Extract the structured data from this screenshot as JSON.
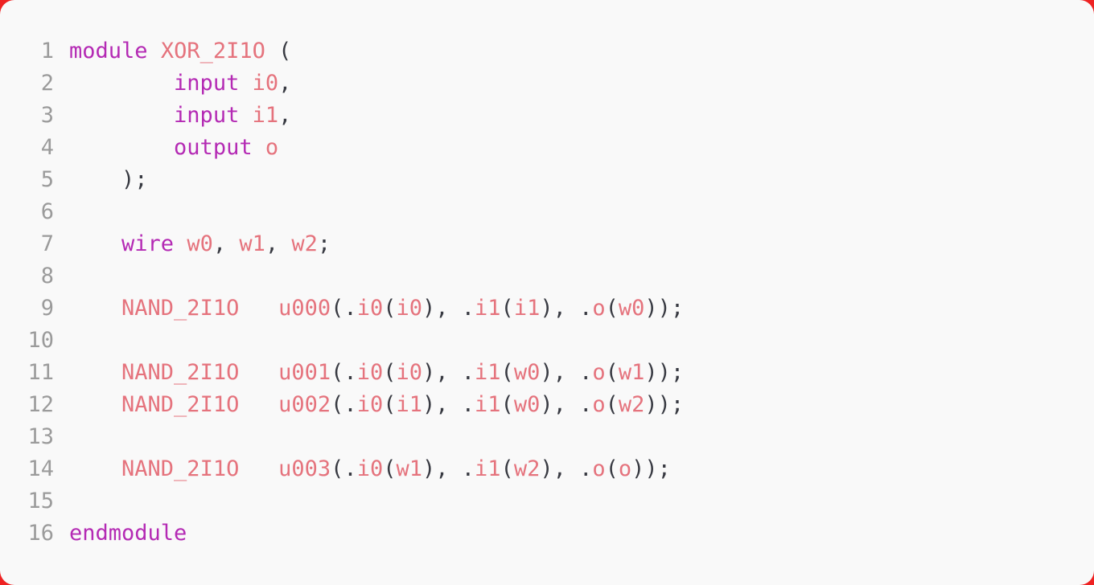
{
  "theme": {
    "page_background": "#ee2222",
    "panel_background": "#f9f9f9",
    "line_number_color": "#9b9b9b",
    "keyword_color": "#b42ab4",
    "identifier_color": "#e5737d",
    "punctuation_color": "#383a42"
  },
  "editor": {
    "language": "verilog",
    "line_count": 16,
    "lines": [
      {
        "number": "1",
        "text": "module XOR_2I1O (",
        "tokens": [
          {
            "t": "module",
            "k": "keyword"
          },
          {
            "t": " ",
            "k": "plain"
          },
          {
            "t": "XOR_2I1O",
            "k": "ident"
          },
          {
            "t": " (",
            "k": "punct"
          }
        ]
      },
      {
        "number": "2",
        "text": "        input i0,",
        "tokens": [
          {
            "t": "        ",
            "k": "plain"
          },
          {
            "t": "input",
            "k": "keyword"
          },
          {
            "t": " ",
            "k": "plain"
          },
          {
            "t": "i0",
            "k": "ident"
          },
          {
            "t": ",",
            "k": "punct"
          }
        ]
      },
      {
        "number": "3",
        "text": "        input i1,",
        "tokens": [
          {
            "t": "        ",
            "k": "plain"
          },
          {
            "t": "input",
            "k": "keyword"
          },
          {
            "t": " ",
            "k": "plain"
          },
          {
            "t": "i1",
            "k": "ident"
          },
          {
            "t": ",",
            "k": "punct"
          }
        ]
      },
      {
        "number": "4",
        "text": "        output o",
        "tokens": [
          {
            "t": "        ",
            "k": "plain"
          },
          {
            "t": "output",
            "k": "keyword"
          },
          {
            "t": " ",
            "k": "plain"
          },
          {
            "t": "o",
            "k": "ident"
          }
        ]
      },
      {
        "number": "5",
        "text": "    );",
        "tokens": [
          {
            "t": "    );",
            "k": "punct"
          }
        ]
      },
      {
        "number": "6",
        "text": "",
        "tokens": []
      },
      {
        "number": "7",
        "text": "    wire w0, w1, w2;",
        "tokens": [
          {
            "t": "    ",
            "k": "plain"
          },
          {
            "t": "wire",
            "k": "keyword"
          },
          {
            "t": " ",
            "k": "plain"
          },
          {
            "t": "w0",
            "k": "ident"
          },
          {
            "t": ", ",
            "k": "punct"
          },
          {
            "t": "w1",
            "k": "ident"
          },
          {
            "t": ", ",
            "k": "punct"
          },
          {
            "t": "w2",
            "k": "ident"
          },
          {
            "t": ";",
            "k": "punct"
          }
        ]
      },
      {
        "number": "8",
        "text": "",
        "tokens": []
      },
      {
        "number": "9",
        "text": "    NAND_2I1O   u000(.i0(i0), .i1(i1), .o(w0));",
        "tokens": [
          {
            "t": "    ",
            "k": "plain"
          },
          {
            "t": "NAND_2I1O",
            "k": "ident"
          },
          {
            "t": "   ",
            "k": "plain"
          },
          {
            "t": "u000",
            "k": "ident"
          },
          {
            "t": "(",
            "k": "punct"
          },
          {
            "t": ".",
            "k": "punct"
          },
          {
            "t": "i0",
            "k": "ident"
          },
          {
            "t": "(",
            "k": "punct"
          },
          {
            "t": "i0",
            "k": "ident"
          },
          {
            "t": "), ",
            "k": "punct"
          },
          {
            "t": ".",
            "k": "punct"
          },
          {
            "t": "i1",
            "k": "ident"
          },
          {
            "t": "(",
            "k": "punct"
          },
          {
            "t": "i1",
            "k": "ident"
          },
          {
            "t": "), ",
            "k": "punct"
          },
          {
            "t": ".",
            "k": "punct"
          },
          {
            "t": "o",
            "k": "ident"
          },
          {
            "t": "(",
            "k": "punct"
          },
          {
            "t": "w0",
            "k": "ident"
          },
          {
            "t": "));",
            "k": "punct"
          }
        ]
      },
      {
        "number": "10",
        "text": "",
        "tokens": []
      },
      {
        "number": "11",
        "text": "    NAND_2I1O   u001(.i0(i0), .i1(w0), .o(w1));",
        "tokens": [
          {
            "t": "    ",
            "k": "plain"
          },
          {
            "t": "NAND_2I1O",
            "k": "ident"
          },
          {
            "t": "   ",
            "k": "plain"
          },
          {
            "t": "u001",
            "k": "ident"
          },
          {
            "t": "(",
            "k": "punct"
          },
          {
            "t": ".",
            "k": "punct"
          },
          {
            "t": "i0",
            "k": "ident"
          },
          {
            "t": "(",
            "k": "punct"
          },
          {
            "t": "i0",
            "k": "ident"
          },
          {
            "t": "), ",
            "k": "punct"
          },
          {
            "t": ".",
            "k": "punct"
          },
          {
            "t": "i1",
            "k": "ident"
          },
          {
            "t": "(",
            "k": "punct"
          },
          {
            "t": "w0",
            "k": "ident"
          },
          {
            "t": "), ",
            "k": "punct"
          },
          {
            "t": ".",
            "k": "punct"
          },
          {
            "t": "o",
            "k": "ident"
          },
          {
            "t": "(",
            "k": "punct"
          },
          {
            "t": "w1",
            "k": "ident"
          },
          {
            "t": "));",
            "k": "punct"
          }
        ]
      },
      {
        "number": "12",
        "text": "    NAND_2I1O   u002(.i0(i1), .i1(w0), .o(w2));",
        "tokens": [
          {
            "t": "    ",
            "k": "plain"
          },
          {
            "t": "NAND_2I1O",
            "k": "ident"
          },
          {
            "t": "   ",
            "k": "plain"
          },
          {
            "t": "u002",
            "k": "ident"
          },
          {
            "t": "(",
            "k": "punct"
          },
          {
            "t": ".",
            "k": "punct"
          },
          {
            "t": "i0",
            "k": "ident"
          },
          {
            "t": "(",
            "k": "punct"
          },
          {
            "t": "i1",
            "k": "ident"
          },
          {
            "t": "), ",
            "k": "punct"
          },
          {
            "t": ".",
            "k": "punct"
          },
          {
            "t": "i1",
            "k": "ident"
          },
          {
            "t": "(",
            "k": "punct"
          },
          {
            "t": "w0",
            "k": "ident"
          },
          {
            "t": "), ",
            "k": "punct"
          },
          {
            "t": ".",
            "k": "punct"
          },
          {
            "t": "o",
            "k": "ident"
          },
          {
            "t": "(",
            "k": "punct"
          },
          {
            "t": "w2",
            "k": "ident"
          },
          {
            "t": "));",
            "k": "punct"
          }
        ]
      },
      {
        "number": "13",
        "text": "",
        "tokens": []
      },
      {
        "number": "14",
        "text": "    NAND_2I1O   u003(.i0(w1), .i1(w2), .o(o));",
        "tokens": [
          {
            "t": "    ",
            "k": "plain"
          },
          {
            "t": "NAND_2I1O",
            "k": "ident"
          },
          {
            "t": "   ",
            "k": "plain"
          },
          {
            "t": "u003",
            "k": "ident"
          },
          {
            "t": "(",
            "k": "punct"
          },
          {
            "t": ".",
            "k": "punct"
          },
          {
            "t": "i0",
            "k": "ident"
          },
          {
            "t": "(",
            "k": "punct"
          },
          {
            "t": "w1",
            "k": "ident"
          },
          {
            "t": "), ",
            "k": "punct"
          },
          {
            "t": ".",
            "k": "punct"
          },
          {
            "t": "i1",
            "k": "ident"
          },
          {
            "t": "(",
            "k": "punct"
          },
          {
            "t": "w2",
            "k": "ident"
          },
          {
            "t": "), ",
            "k": "punct"
          },
          {
            "t": ".",
            "k": "punct"
          },
          {
            "t": "o",
            "k": "ident"
          },
          {
            "t": "(",
            "k": "punct"
          },
          {
            "t": "o",
            "k": "ident"
          },
          {
            "t": "));",
            "k": "punct"
          }
        ]
      },
      {
        "number": "15",
        "text": "",
        "tokens": []
      },
      {
        "number": "16",
        "text": "endmodule",
        "tokens": [
          {
            "t": "endmodule",
            "k": "keyword"
          }
        ]
      }
    ]
  }
}
